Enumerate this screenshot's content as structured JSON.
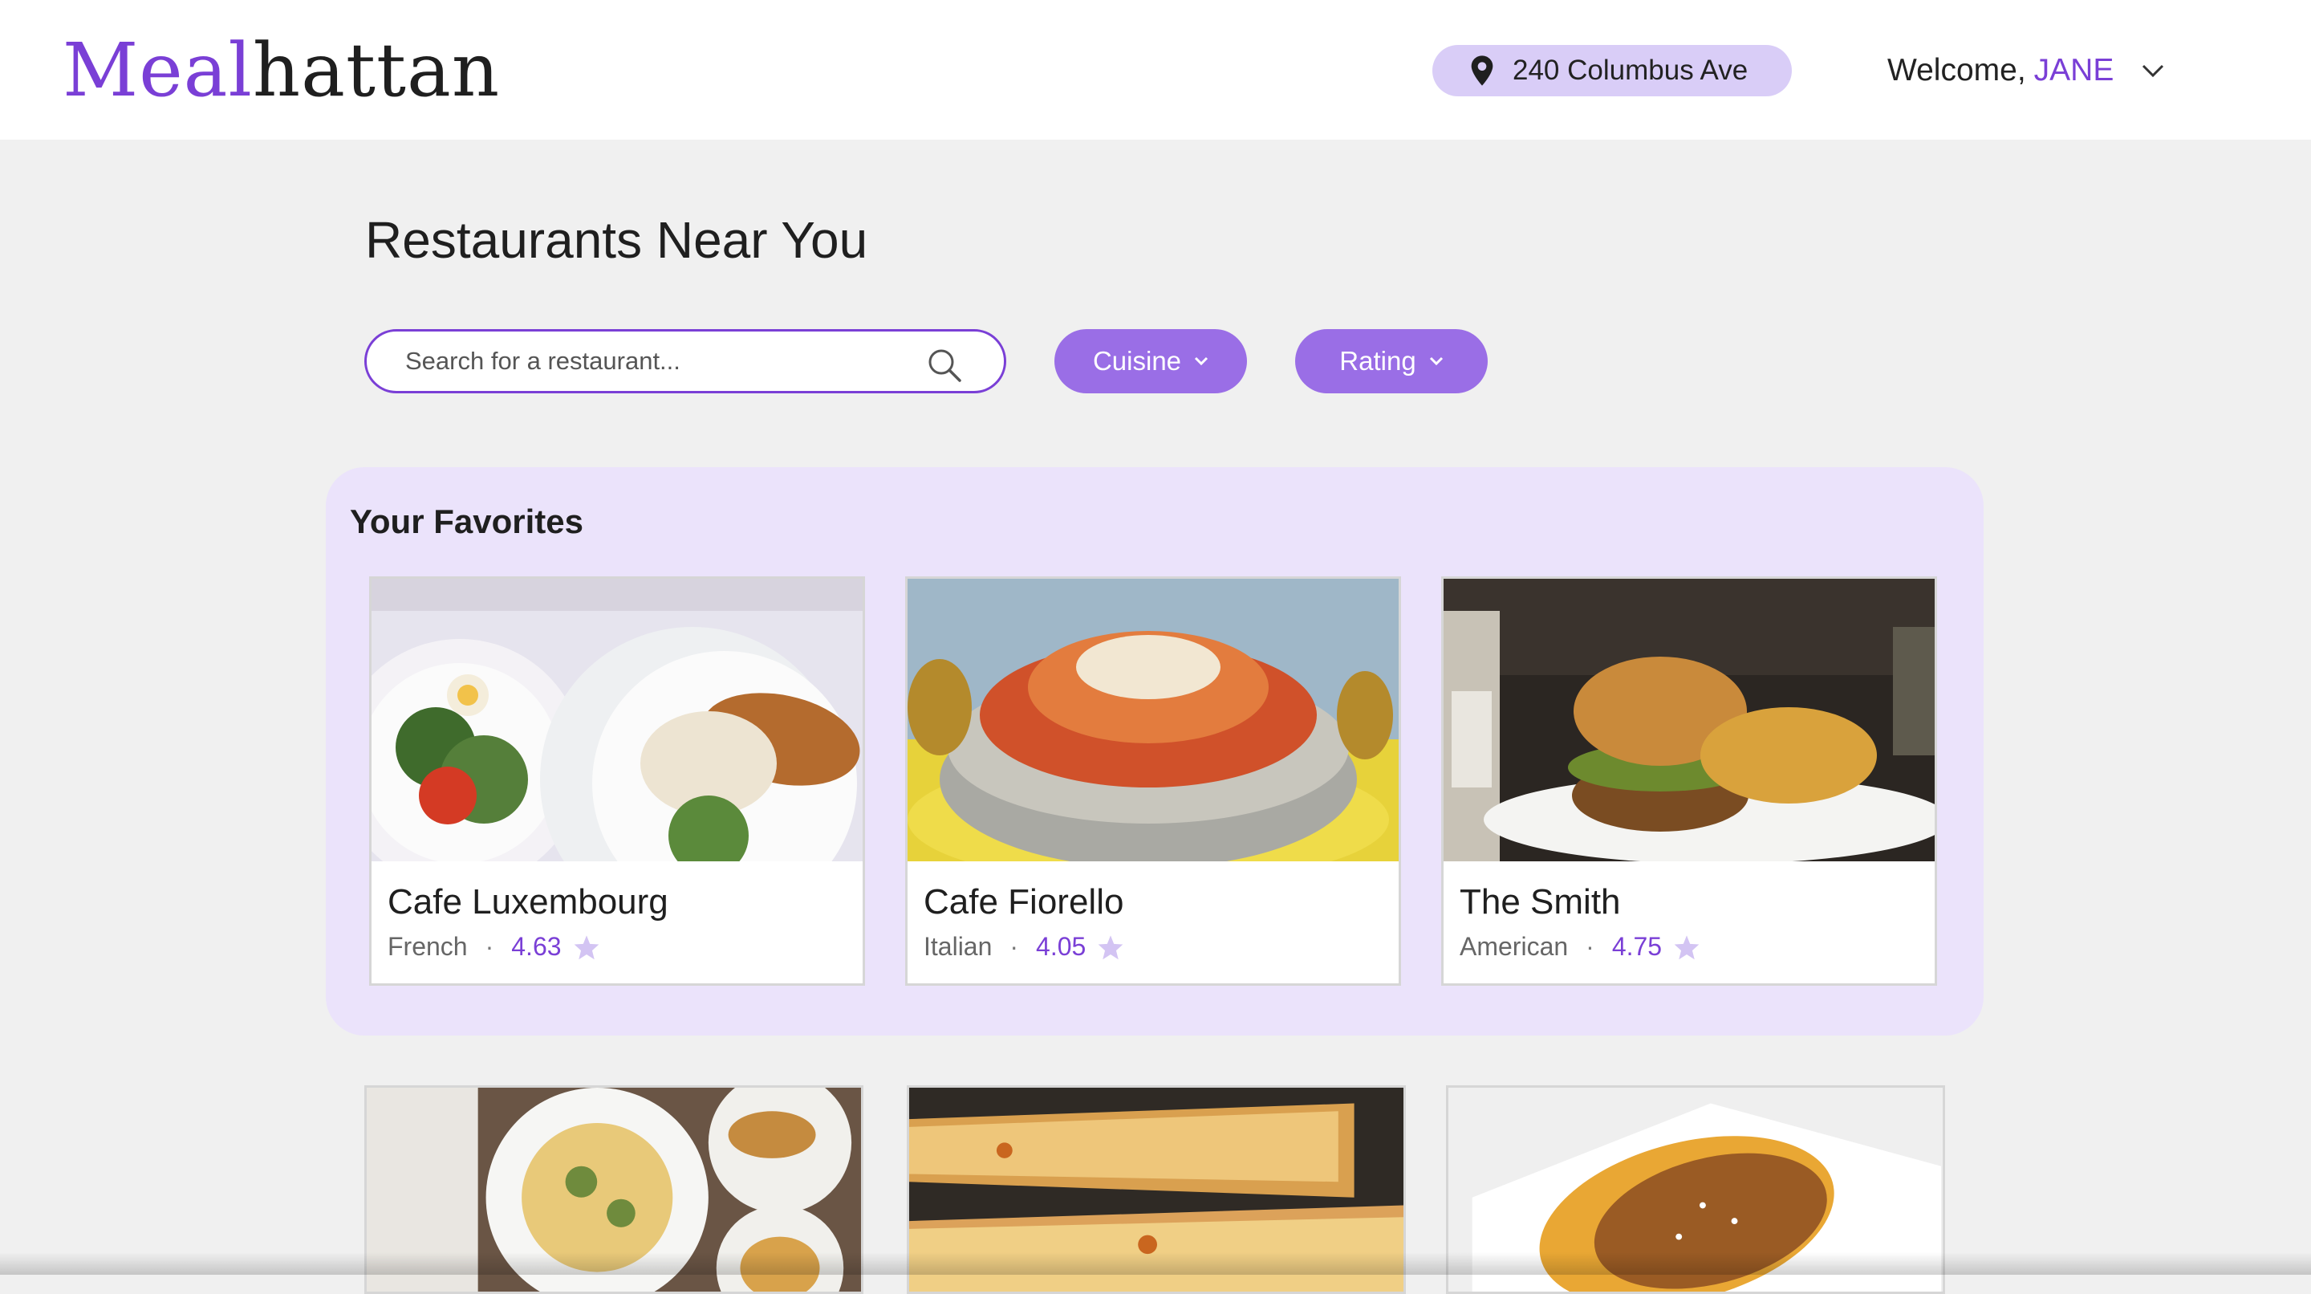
{
  "header": {
    "logo_part1": "Meal",
    "logo_part2": "hattan",
    "address": "240 Columbus Ave",
    "welcome_prefix": "Welcome,",
    "user_name": "JANE"
  },
  "main": {
    "title": "Restaurants Near You",
    "search_placeholder": "Search for a restaurant...",
    "filters": {
      "cuisine": "Cuisine",
      "rating": "Rating"
    }
  },
  "favorites": {
    "title": "Your Favorites",
    "cards": [
      {
        "name": "Cafe Luxembourg",
        "cuisine": "French",
        "rating": "4.63"
      },
      {
        "name": "Cafe Fiorello",
        "cuisine": "Italian",
        "rating": "4.05"
      },
      {
        "name": "The Smith",
        "cuisine": "American",
        "rating": "4.75"
      }
    ],
    "separator": "·"
  },
  "colors": {
    "accent": "#7a3fd6",
    "button": "#9a6ee6",
    "pill": "#d9cdf7",
    "favorites_bg": "#ebe3fb",
    "star": "#d3c4f3"
  },
  "icons": {
    "location": "location-pin-icon",
    "dropdown": "chevron-down-icon",
    "search": "search-icon",
    "rating": "star-icon"
  }
}
